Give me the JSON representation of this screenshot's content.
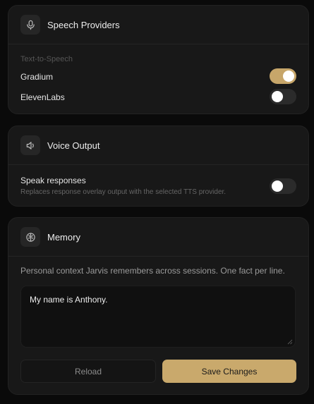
{
  "speech": {
    "title": "Speech Providers",
    "icon": "microphone-icon",
    "section_label": "Text-to-Speech",
    "providers": [
      {
        "label": "Gradium",
        "enabled": true
      },
      {
        "label": "ElevenLabs",
        "enabled": false
      }
    ]
  },
  "voice": {
    "title": "Voice Output",
    "icon": "speaker-icon",
    "speak_label": "Speak responses",
    "speak_sub": "Replaces response overlay output with the selected TTS provider.",
    "speak_enabled": false
  },
  "memory": {
    "title": "Memory",
    "icon": "brain-icon",
    "description": "Personal context Jarvis remembers across sessions. One fact per line.",
    "text": "My name is Anthony.",
    "reload_label": "Reload",
    "save_label": "Save Changes"
  },
  "colors": {
    "accent": "#c9a96c",
    "background": "#0a0a0a",
    "card": "#181818"
  }
}
